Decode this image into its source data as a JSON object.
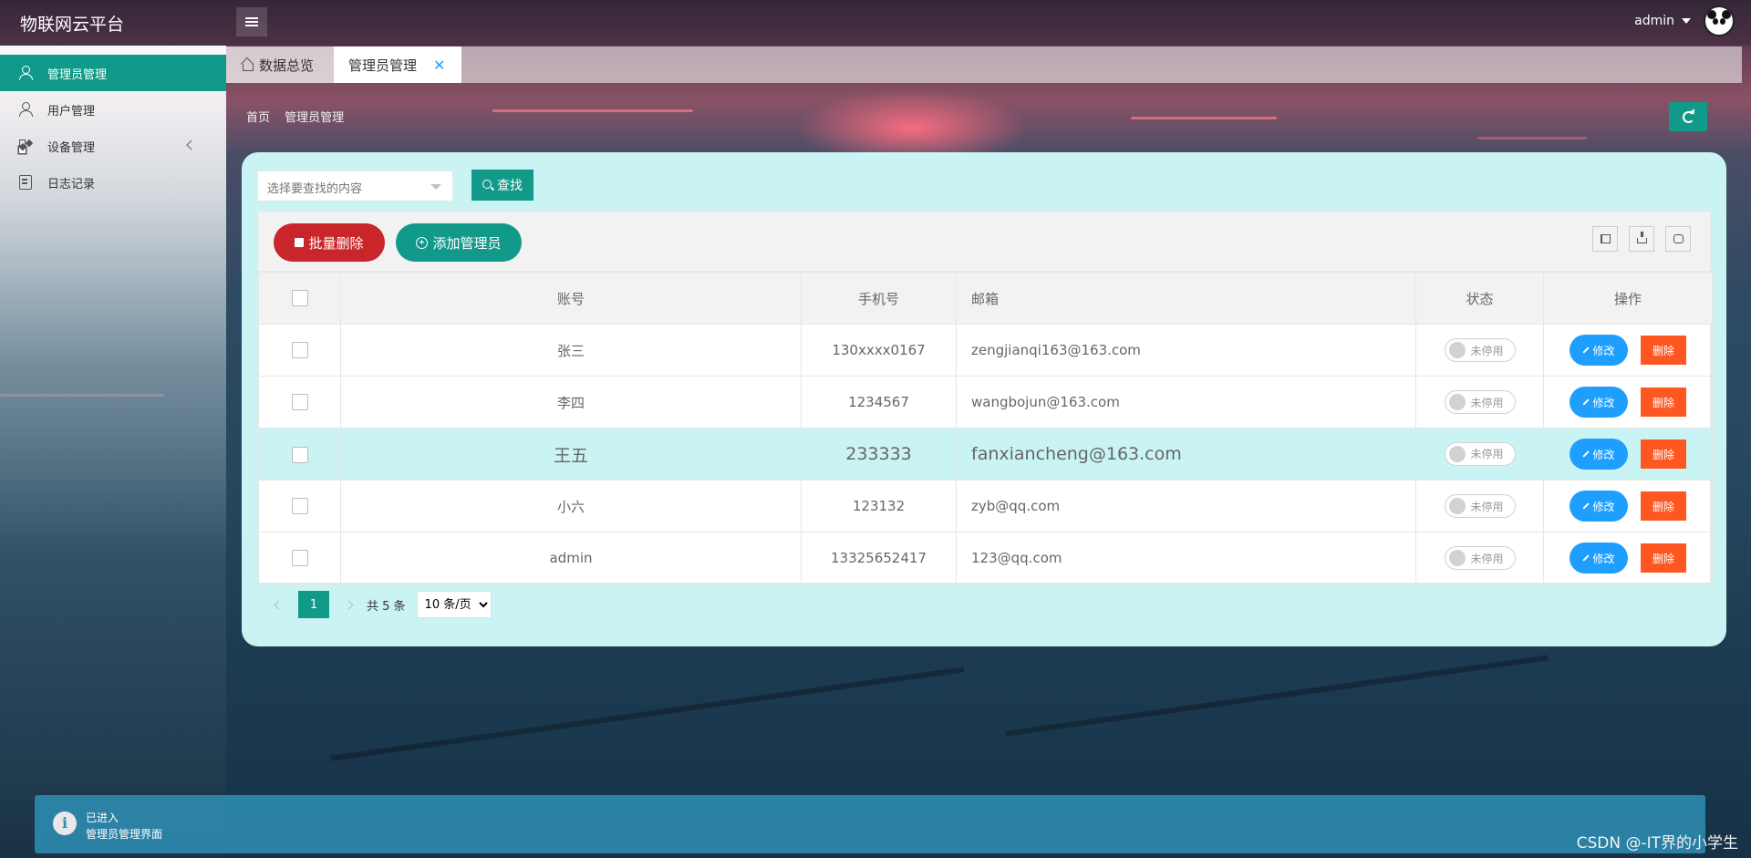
{
  "header": {
    "logo": "物联网云平台",
    "username": "admin"
  },
  "sidebar": {
    "items": [
      {
        "label": "管理员管理",
        "icon": "user-icon",
        "active": true
      },
      {
        "label": "用户管理",
        "icon": "user-icon"
      },
      {
        "label": "设备管理",
        "icon": "device-grid-icon",
        "has_children": true
      },
      {
        "label": "日志记录",
        "icon": "log-icon"
      }
    ]
  },
  "tabs": [
    {
      "label": "数据总览",
      "icon": "home-icon"
    },
    {
      "label": "管理员管理",
      "active": true,
      "closable": true,
      "close_label": "✕"
    }
  ],
  "breadcrumb": [
    "首页",
    "管理员管理"
  ],
  "search": {
    "placeholder": "选择要查找的内容",
    "button_label": "查找"
  },
  "toolbar": {
    "batch_delete_label": "批量删除",
    "add_label": "添加管理员"
  },
  "table": {
    "headers": [
      "账号",
      "手机号",
      "邮箱",
      "状态",
      "操作"
    ],
    "rows": [
      {
        "account": "张三",
        "phone": "130xxxx0167",
        "email": "zengjianqi163@163.com",
        "status": "未停用"
      },
      {
        "account": "李四",
        "phone": "1234567",
        "email": "wangbojun@163.com",
        "status": "未停用"
      },
      {
        "account": "王五",
        "phone": "233333",
        "email": "fanxiancheng@163.com",
        "status": "未停用",
        "highlighted": true
      },
      {
        "account": "小六",
        "phone": "123132",
        "email": "zyb@qq.com",
        "status": "未停用"
      },
      {
        "account": "admin",
        "phone": "13325652417",
        "email": "123@qq.com",
        "status": "未停用"
      }
    ],
    "edit_label": "修改",
    "delete_label": "删除"
  },
  "pagination": {
    "current_page": "1",
    "total_text": "共 5 条",
    "page_size": "10 条/页"
  },
  "notification": {
    "title": "已进入",
    "body": "管理员管理界面"
  },
  "watermark": "CSDN @-IT界的小学生",
  "colors": {
    "primary": "#119a8a",
    "danger": "#c8262a",
    "edit": "#1e9fff",
    "remove": "#ff5722",
    "card_bg": "#c9f4f3"
  }
}
